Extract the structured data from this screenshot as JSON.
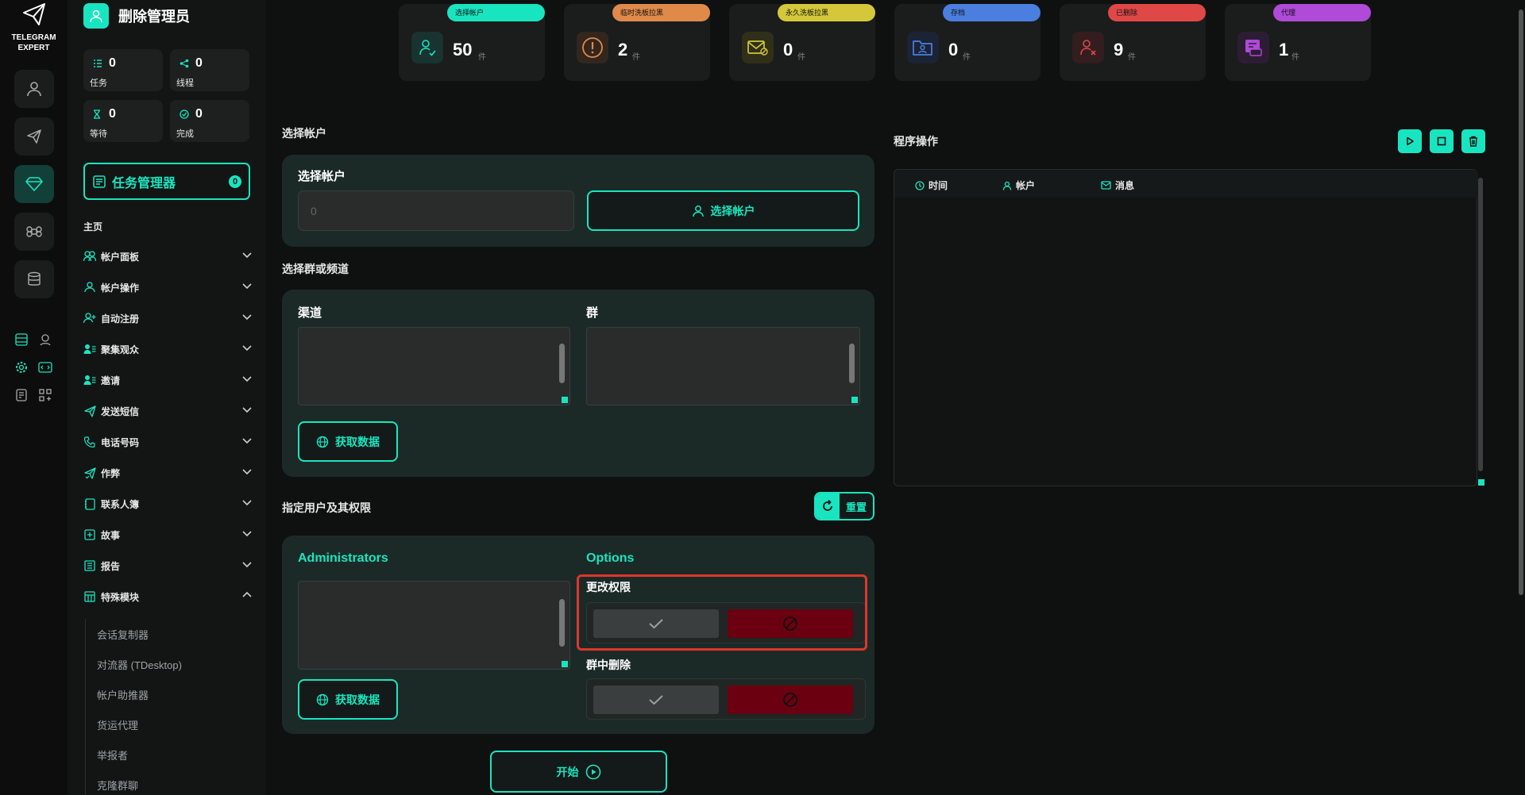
{
  "app": {
    "logo_line1": "TELEGRAM",
    "logo_line2": "EXPERT"
  },
  "sidebar": {
    "title": "删除管理员",
    "stats": [
      {
        "value": "0",
        "label": "任务"
      },
      {
        "value": "0",
        "label": "线程"
      },
      {
        "value": "0",
        "label": "等待"
      },
      {
        "value": "0",
        "label": "完成"
      }
    ],
    "task_manager": {
      "label": "任务管理器",
      "count": "0"
    },
    "section_label": "主页",
    "nav": [
      {
        "label": "帐户面板"
      },
      {
        "label": "帐户操作"
      },
      {
        "label": "自动注册"
      },
      {
        "label": "聚集观众"
      },
      {
        "label": "邀请"
      },
      {
        "label": "发送短信"
      },
      {
        "label": "电话号码"
      },
      {
        "label": "作弊"
      },
      {
        "label": "联系人簿"
      },
      {
        "label": "故事"
      },
      {
        "label": "报告"
      },
      {
        "label": "特殊模块"
      }
    ],
    "sub_items": [
      "会话复制器",
      "对流器 (TDesktop)",
      "帐户助推器",
      "货运代理",
      "举报者",
      "克隆群聊"
    ]
  },
  "top_stats": [
    {
      "tag": "选择帐户",
      "value": "50",
      "unit": "件",
      "color": "#18e5c0"
    },
    {
      "tag": "临时洗板拉黑",
      "value": "2",
      "unit": "件",
      "color": "#e08a4a"
    },
    {
      "tag": "永久洗板拉黑",
      "value": "0",
      "unit": "件",
      "color": "#d4c83a"
    },
    {
      "tag": "存档",
      "value": "0",
      "unit": "件",
      "color": "#4a7fe0"
    },
    {
      "tag": "已删除",
      "value": "9",
      "unit": "件",
      "color": "#e04848"
    },
    {
      "tag": "代理",
      "value": "1",
      "unit": "件",
      "color": "#b04ad8"
    }
  ],
  "account_section": {
    "heading": "选择帐户",
    "field_label": "选择帐户",
    "input_placeholder": "0",
    "button_label": "选择帐户"
  },
  "channel_section": {
    "heading": "选择群或频道",
    "channel_label": "渠道",
    "group_label": "群",
    "fetch_label": "获取数据"
  },
  "rights_section": {
    "heading": "指定用户及其权限",
    "reset_label": "重置",
    "admins_label": "Administrators",
    "options_label": "Options",
    "fetch_label": "获取数据",
    "options": [
      {
        "label": "更改权限"
      },
      {
        "label": "群中删除"
      }
    ]
  },
  "start_label": "开始",
  "program": {
    "heading": "程序操作",
    "columns": [
      "时间",
      "帐户",
      "消息"
    ]
  },
  "colors": {
    "accent": "#18e5c0",
    "deny": "#6b0010",
    "highlight": "#e0352b"
  }
}
